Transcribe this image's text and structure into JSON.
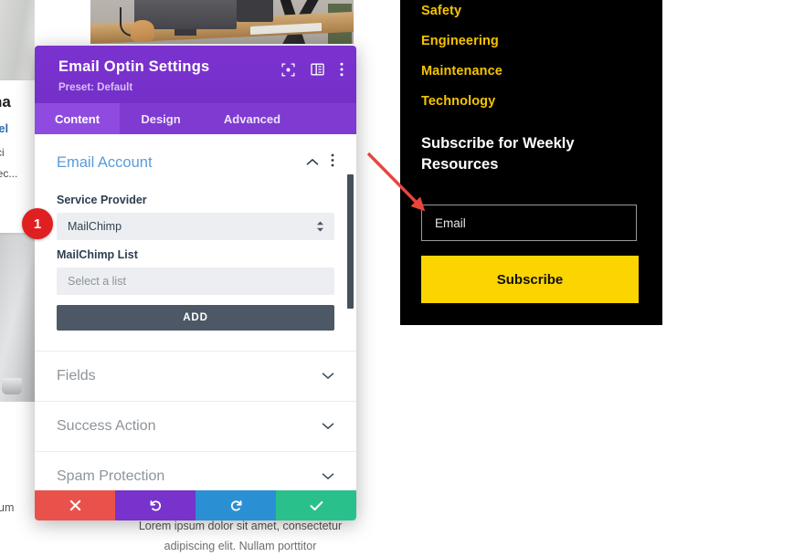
{
  "background": {
    "card": {
      "heading_fragment": "na",
      "link_fragment": "vel",
      "text_fragment_1": "rci",
      "text_fragment_2": "nec..."
    },
    "edge_text_fragment": "um",
    "lorem_line_1": "Lorem ipsum dolor sit amet, consectetur",
    "lorem_line_2": "adipiscing elit. Nullam porttitor"
  },
  "optin_widget": {
    "menu": [
      {
        "label": "Safety"
      },
      {
        "label": "Engineering"
      },
      {
        "label": "Maintenance"
      },
      {
        "label": "Technology"
      }
    ],
    "title": "Subscribe for Weekly Resources",
    "email_placeholder": "Email",
    "email_value": "",
    "subscribe_label": "Subscribe",
    "colors": {
      "background": "#000000",
      "menu_link": "#f5c400",
      "button": "#fcd500",
      "title": "#ffffff"
    }
  },
  "settings_modal": {
    "title": "Email Optin Settings",
    "preset": "Preset: Default",
    "header_icons": [
      {
        "name": "focus-view-icon"
      },
      {
        "name": "split-view-icon"
      },
      {
        "name": "more-options-icon"
      }
    ],
    "tabs": [
      {
        "label": "Content",
        "active": true
      },
      {
        "label": "Design",
        "active": false
      },
      {
        "label": "Advanced",
        "active": false
      }
    ],
    "open_section": {
      "title": "Email Account",
      "fields": {
        "service_provider_label": "Service Provider",
        "service_provider_value": "MailChimp",
        "list_label": "MailChimp List",
        "list_placeholder": "Select a list",
        "list_value": "",
        "add_label": "ADD"
      }
    },
    "collapsed_sections": [
      {
        "title": "Fields"
      },
      {
        "title": "Success Action"
      },
      {
        "title": "Spam Protection"
      }
    ],
    "actions": [
      {
        "name": "cancel",
        "glyph": "✕",
        "color": "#e8524b"
      },
      {
        "name": "undo",
        "glyph": "↺",
        "color": "#7733cc"
      },
      {
        "name": "redo",
        "glyph": "↻",
        "color": "#2b8fd4"
      },
      {
        "name": "save",
        "glyph": "✔",
        "color": "#2ac08c"
      }
    ],
    "colors": {
      "header": "#7733cc",
      "tab_active": "#8f4be0",
      "section_title": "#5a9bd8"
    }
  },
  "annotations": {
    "step_badge": "1",
    "arrow_color": "#e8453c"
  }
}
